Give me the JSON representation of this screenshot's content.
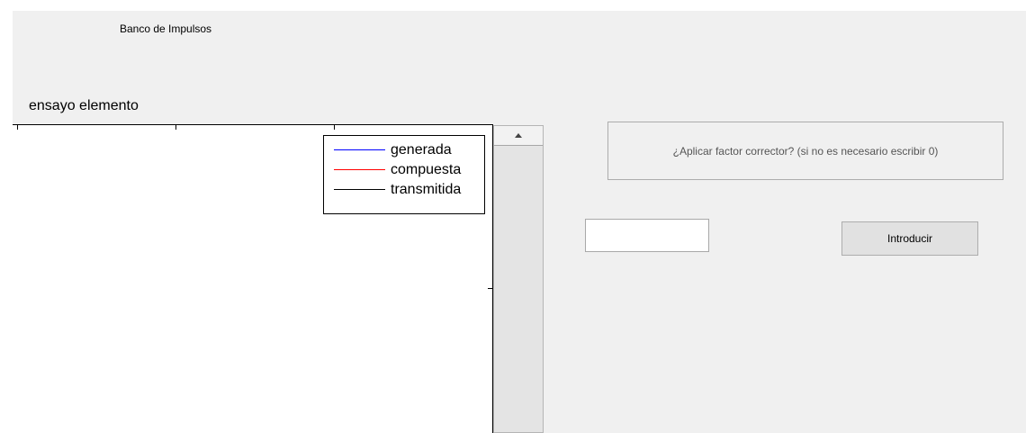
{
  "window": {
    "title": "Banco de Impulsos"
  },
  "plot": {
    "title": "ensayo elemento",
    "legend": [
      {
        "label": "generada",
        "color": "#0000ff"
      },
      {
        "label": "compuesta",
        "color": "#ff0000"
      },
      {
        "label": "transmitida",
        "color": "#000000"
      }
    ]
  },
  "scrollbar": {
    "up_icon": "triangle-up-icon"
  },
  "prompt": {
    "text": "¿Aplicar factor corrector? (si no es necesario escribir 0)"
  },
  "input": {
    "value": ""
  },
  "button": {
    "label": "Introducir"
  }
}
